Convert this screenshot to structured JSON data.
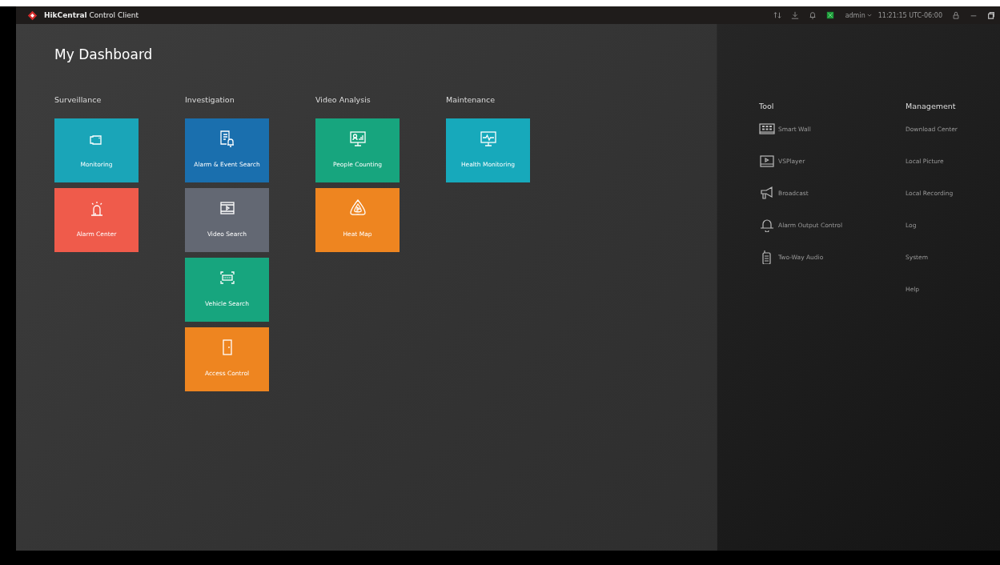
{
  "window": {
    "title": "**HikCentral** Control Client",
    "user": "admin",
    "clock": "11:21:15 UTC-06:00"
  },
  "dashboard": {
    "title": "My Dashboard",
    "groups": [
      {
        "label": "Surveillance",
        "tiles": [
          {
            "label": "Monitoring",
            "kind": "camera",
            "color": "#1aa5b8"
          },
          {
            "label": "Alarm Center",
            "kind": "siren",
            "color": "#ef5b4b"
          }
        ]
      },
      {
        "label": "Investigation",
        "tiles": [
          {
            "label": "Alarm & Event Search",
            "kind": "alarmdoc",
            "color": "#1a6fae"
          },
          {
            "label": "Video Search",
            "kind": "video",
            "color": "#636873"
          },
          {
            "label": "Vehicle Search",
            "kind": "plate",
            "color": "#17a57e"
          },
          {
            "label": "Access Control",
            "kind": "door",
            "color": "#ee8520"
          }
        ]
      },
      {
        "label": "Video Analysis",
        "tiles": [
          {
            "label": "People Counting",
            "kind": "people",
            "color": "#17a57e"
          },
          {
            "label": "Heat Map",
            "kind": "heat",
            "color": "#ee8520"
          }
        ]
      },
      {
        "label": "Maintenance",
        "tiles": [
          {
            "label": "Health Monitoring",
            "kind": "health",
            "color": "#17a9bb"
          }
        ]
      }
    ]
  },
  "tool": {
    "label": "Tool",
    "items": [
      {
        "label": "Smart Wall",
        "kind": "wall"
      },
      {
        "label": "VSPlayer",
        "kind": "player"
      },
      {
        "label": "Broadcast",
        "kind": "horn"
      },
      {
        "label": "Alarm Output Control",
        "kind": "bell"
      },
      {
        "label": "Two-Way Audio",
        "kind": "radio"
      }
    ]
  },
  "management": {
    "label": "Management",
    "items": [
      "Download Center",
      "Local Picture",
      "Local Recording",
      "Log",
      "System",
      "Help"
    ]
  }
}
